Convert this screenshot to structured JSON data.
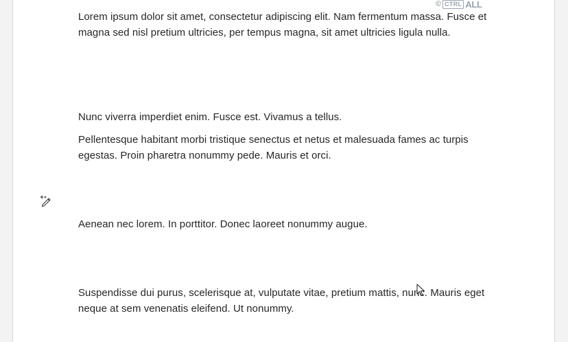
{
  "watermark": {
    "copyright_symbol": "©",
    "ctrl_label": "CTRL",
    "all_label": "ALL",
    "color": "#9aa3ad"
  },
  "document": {
    "paragraphs": [
      "Lorem ipsum dolor sit amet, consectetur adipiscing elit. Nam fermentum massa. Fusce et magna sed nisl pretium ultricies, per tempus magna, sit amet ultricies ligula nulla.",
      "Nunc viverra imperdiet enim. Fusce est. Vivamus a tellus.",
      "Pellentesque habitant morbi tristique senectus et netus et malesuada fames ac turpis egestas. Proin pharetra nonummy pede. Mauris et orci.",
      "Aenean nec lorem. In porttitor. Donec laoreet nonummy augue.",
      "Suspendisse dui purus, scelerisque at, vulputate vitae, pretium mattis, nunc. Mauris eget neque at sem venenatis eleifend. Ut nonummy."
    ],
    "text_color": "#262626"
  },
  "icons": {
    "ai_rewrite": "magic-pen-icon",
    "cursor": "mouse-pointer-icon"
  }
}
